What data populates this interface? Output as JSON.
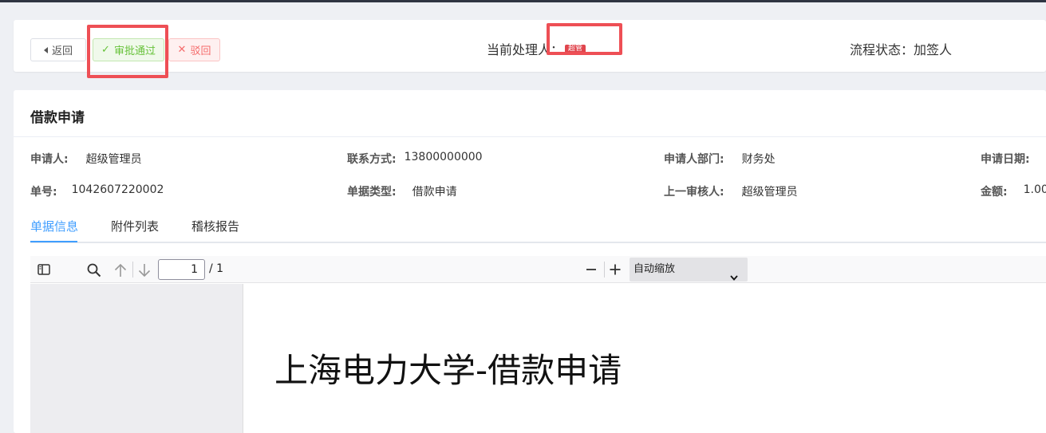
{
  "header": {
    "back_label": "返回",
    "approve_label": "审批通过",
    "reject_label": "驳回",
    "handler_label": "当前处理人：",
    "handler_name": "超管",
    "status_label": "流程状态：加签人"
  },
  "panel": {
    "title": "借款申请",
    "fields": {
      "applicant_label": "申请人:",
      "applicant_value": "超级管理员",
      "contact_label": "联系方式:",
      "contact_value": "13800000000",
      "dept_label": "申请人部门:",
      "dept_value": "财务处",
      "date_label": "申请日期:",
      "order_label": "单号:",
      "order_value": "1042607220002",
      "type_label": "单据类型:",
      "type_value": "借款申请",
      "prev_label": "上一审核人:",
      "prev_value": "超级管理员",
      "amount_label": "金额:",
      "amount_value": "1.00"
    },
    "tabs": [
      "单据信息",
      "附件列表",
      "稽核报告"
    ],
    "active_tab": 0
  },
  "viewer": {
    "page_current": "1",
    "page_total": "/ 1",
    "zoom": "自动缩放",
    "document_title": "上海电力大学-借款申请"
  },
  "colors": {
    "accent": "#409eff",
    "approve": "#67c23a",
    "reject": "#f56c6c",
    "highlight": "#ee4f55"
  }
}
